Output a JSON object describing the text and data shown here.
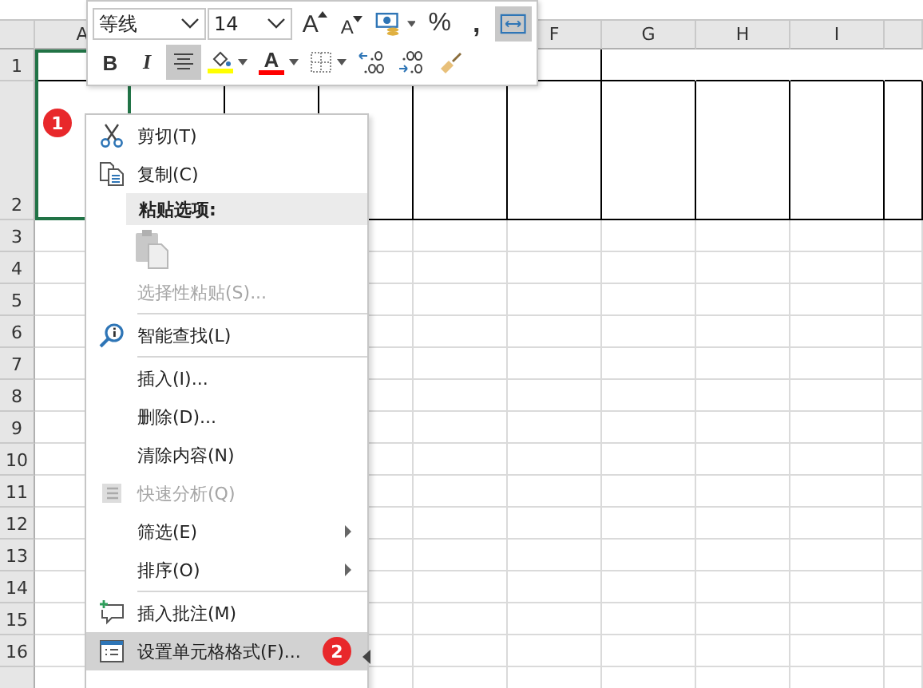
{
  "sheet": {
    "columns": [
      "A",
      "F",
      "G",
      "H",
      "I"
    ],
    "rows": [
      "1",
      "2",
      "3",
      "4",
      "5",
      "6",
      "7",
      "8",
      "9",
      "10",
      "11",
      "12",
      "13",
      "14",
      "15",
      "16"
    ],
    "badge": "1"
  },
  "mini_toolbar": {
    "rows": [
      [
        {
          "kind": "font-select",
          "value": "等线"
        },
        {
          "kind": "size-select",
          "value": "14"
        },
        {
          "kind": "grow-font",
          "text": "A",
          "selected": false
        },
        {
          "kind": "shrink-font",
          "text": "A",
          "selected": false
        },
        {
          "kind": "accounting",
          "split": true,
          "selected": false
        },
        {
          "kind": "percent",
          "text": "%",
          "selected": false
        },
        {
          "kind": "comma",
          "text": ",",
          "selected": false
        },
        {
          "kind": "wrap",
          "selected": true
        }
      ],
      [
        {
          "kind": "bold",
          "text": "B",
          "selected": false
        },
        {
          "kind": "italic",
          "text": "I",
          "selected": false
        },
        {
          "kind": "align-center",
          "selected": true
        },
        {
          "kind": "fill-color",
          "split": true,
          "color": "#ffff00",
          "selected": false
        },
        {
          "kind": "font-color",
          "text": "A",
          "split": true,
          "color": "#ff0000",
          "selected": false
        },
        {
          "kind": "borders",
          "split": true,
          "selected": false
        },
        {
          "kind": "increase-decimal",
          "selected": false
        },
        {
          "kind": "decrease-decimal",
          "selected": false
        },
        {
          "kind": "format-painter",
          "selected": false
        }
      ]
    ]
  },
  "context_menu": {
    "items": [
      {
        "kind": "item",
        "label": "剪切(T)",
        "disabled": false,
        "selected": false
      },
      {
        "kind": "item",
        "label": "复制(C)",
        "disabled": false,
        "selected": false
      },
      {
        "kind": "header",
        "label": "粘贴选项:"
      },
      {
        "kind": "paste-options"
      },
      {
        "kind": "item",
        "label": "选择性粘贴(S)...",
        "disabled": true,
        "selected": false
      },
      {
        "kind": "separator"
      },
      {
        "kind": "item",
        "label": "智能查找(L)",
        "disabled": false,
        "selected": false
      },
      {
        "kind": "separator"
      },
      {
        "kind": "item",
        "label": "插入(I)...",
        "disabled": false,
        "selected": false
      },
      {
        "kind": "item",
        "label": "删除(D)...",
        "disabled": false,
        "selected": false
      },
      {
        "kind": "item",
        "label": "清除内容(N)",
        "disabled": false,
        "selected": false
      },
      {
        "kind": "item",
        "label": "快速分析(Q)",
        "disabled": true,
        "selected": false
      },
      {
        "kind": "item",
        "label": "筛选(E)",
        "disabled": false,
        "selected": false,
        "submenu": true
      },
      {
        "kind": "item",
        "label": "排序(O)",
        "disabled": false,
        "selected": false,
        "submenu": true
      },
      {
        "kind": "separator"
      },
      {
        "kind": "item",
        "label": "插入批注(M)",
        "disabled": false,
        "selected": false
      },
      {
        "kind": "item",
        "label": "设置单元格格式(F)...",
        "disabled": false,
        "selected": true,
        "badge": "2"
      }
    ]
  }
}
